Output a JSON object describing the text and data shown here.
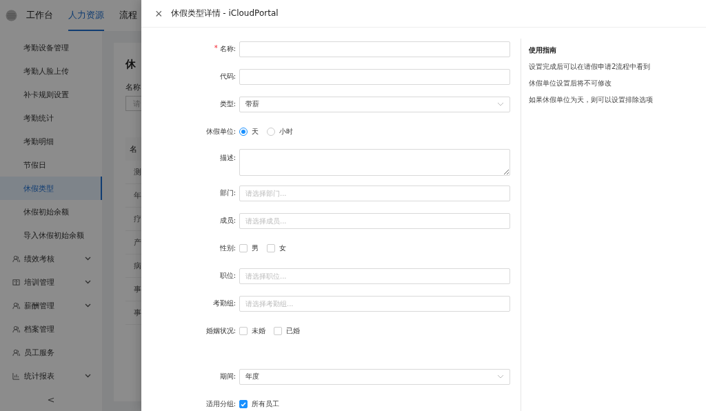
{
  "topbar": {
    "tabs": [
      {
        "label": "工作台",
        "selected": false
      },
      {
        "label": "人力资源",
        "selected": true
      },
      {
        "label": "流程",
        "selected": false
      }
    ]
  },
  "sidebar": {
    "items": [
      {
        "label": "考勤设备管理",
        "kind": "sub",
        "selected": false
      },
      {
        "label": "考勤人脸上传",
        "kind": "sub",
        "selected": false
      },
      {
        "label": "补卡规则设置",
        "kind": "sub",
        "selected": false
      },
      {
        "label": "考勤统计",
        "kind": "sub",
        "selected": false
      },
      {
        "label": "考勤明细",
        "kind": "sub",
        "selected": false
      },
      {
        "label": "节假日",
        "kind": "sub",
        "selected": false
      },
      {
        "label": "休假类型",
        "kind": "sub",
        "selected": true
      },
      {
        "label": "休假初始余额",
        "kind": "sub",
        "selected": false
      },
      {
        "label": "导入休假初始余额",
        "kind": "sub",
        "selected": false
      },
      {
        "label": "绩效考核",
        "kind": "people",
        "expanded": false,
        "selected": false
      },
      {
        "label": "培训管理",
        "kind": "book",
        "expanded": false,
        "selected": false
      },
      {
        "label": "薪酬管理",
        "kind": "people",
        "expanded": false,
        "selected": false
      },
      {
        "label": "档案管理",
        "kind": "people",
        "selected": false
      },
      {
        "label": "员工服务",
        "kind": "people",
        "selected": false
      },
      {
        "label": "统计报表",
        "kind": "chart",
        "expanded": false,
        "selected": false
      }
    ],
    "collapse": "<"
  },
  "background_page": {
    "title": "休",
    "filter_label": "名称",
    "filter_placeholder": "请",
    "table": {
      "columns": [
        "名"
      ],
      "rows": [
        "测",
        "年",
        "疗",
        "产",
        "病",
        "事",
        "事"
      ]
    }
  },
  "drawer": {
    "close": "×",
    "title": "休假类型详情 - iCloudPortal",
    "fields": [
      {
        "label": "名称:",
        "kind": "input",
        "required_mark": "*"
      },
      {
        "label": "代码:",
        "kind": "input"
      },
      {
        "label": "类型:",
        "kind": "select",
        "value": "带薪"
      },
      {
        "label": "休假单位:",
        "kind": "radio",
        "options": [
          {
            "label": "天",
            "selected": true
          },
          {
            "label": "小时",
            "selected": false
          }
        ]
      },
      {
        "label": "描述:",
        "kind": "textarea"
      },
      {
        "label": "部门:",
        "kind": "input",
        "placeholder": "请选择部门..."
      },
      {
        "label": "成员:",
        "kind": "input",
        "placeholder": "请选择成员..."
      },
      {
        "label": "性别:",
        "kind": "checkbox",
        "options": [
          {
            "label": "男",
            "checked": false
          },
          {
            "label": "女",
            "checked": false
          }
        ]
      },
      {
        "label": "职位:",
        "kind": "input",
        "placeholder": "请选择职位..."
      },
      {
        "label": "考勤组:",
        "kind": "input",
        "placeholder": "请选择考勤组..."
      },
      {
        "label": "婚姻状况:",
        "kind": "checkbox",
        "options": [
          {
            "label": "未婚",
            "checked": false
          },
          {
            "label": "已婚",
            "checked": false
          }
        ]
      },
      {
        "kind": "spacer"
      },
      {
        "label": "期间:",
        "kind": "select",
        "value": "年度"
      },
      {
        "label": "适用分组:",
        "kind": "checkbox",
        "options": [
          {
            "label": "所有员工",
            "checked": true
          }
        ]
      }
    ],
    "guide": {
      "title": "使用指南",
      "lines": [
        "设置完成后可以在请假申请2流程中看到",
        "休假单位设置后将不可修改",
        "如果休假单位为天，则可以设置排除选项"
      ]
    }
  }
}
